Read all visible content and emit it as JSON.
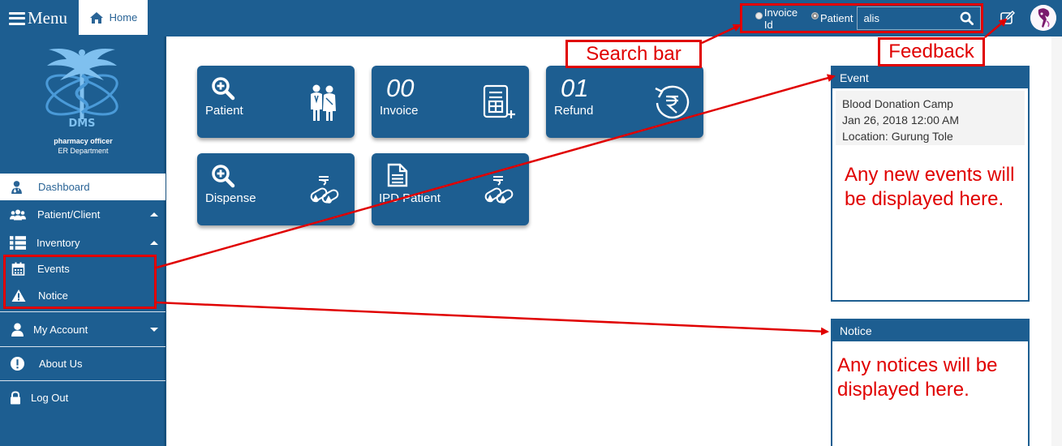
{
  "topbar": {
    "menu_label": "Menu",
    "home_label": "Home",
    "search": {
      "option_invoice": "Invoice Id",
      "option_patient": "Patient",
      "selected": "Patient",
      "query": "alis"
    }
  },
  "sidebar": {
    "role": "pharmacy officer",
    "department": "ER Department",
    "logo_text": "DMS",
    "items": [
      {
        "label": "Dashboard",
        "icon": "user-md-icon",
        "active": true
      },
      {
        "label": "Patient/Client",
        "icon": "users-icon",
        "expanded": true
      },
      {
        "label": "Inventory",
        "icon": "list-icon",
        "expanded": true
      },
      {
        "label": "Events",
        "icon": "calendar-icon"
      },
      {
        "label": "Notice",
        "icon": "warning-icon"
      },
      {
        "label": "My Account",
        "icon": "user-icon",
        "expanded": false
      },
      {
        "label": "About Us",
        "icon": "info-icon"
      },
      {
        "label": "Log Out",
        "icon": "lock-icon"
      }
    ]
  },
  "tiles": [
    {
      "label": "Patient",
      "icon": "search-plus-icon",
      "illustration": "doctor-patient-icon"
    },
    {
      "label": "Invoice",
      "count": "00",
      "icon": "invoice-add-icon"
    },
    {
      "label": "Refund",
      "count": "01",
      "icon": "rupee-refund-icon"
    },
    {
      "label": "Dispense",
      "icon": "search-plus-icon",
      "illustration": "capsule-dispense-icon"
    },
    {
      "label": "IPD Patient",
      "icon": "document-icon",
      "illustration": "capsule-dispense-icon"
    }
  ],
  "event_panel": {
    "title": "Event",
    "entry": {
      "name": "Blood Donation Camp",
      "datetime": "Jan 26, 2018 12:00 AM",
      "location": "Location: Gurung Tole"
    },
    "note": "Any new events will be displayed here."
  },
  "notice_panel": {
    "title": "Notice",
    "note": "Any notices will be displayed here."
  },
  "annotations": {
    "search_bar": "Search bar",
    "feedback": "Feedback"
  },
  "colors": {
    "primary": "#1d5e91",
    "annotation": "#e00000"
  }
}
